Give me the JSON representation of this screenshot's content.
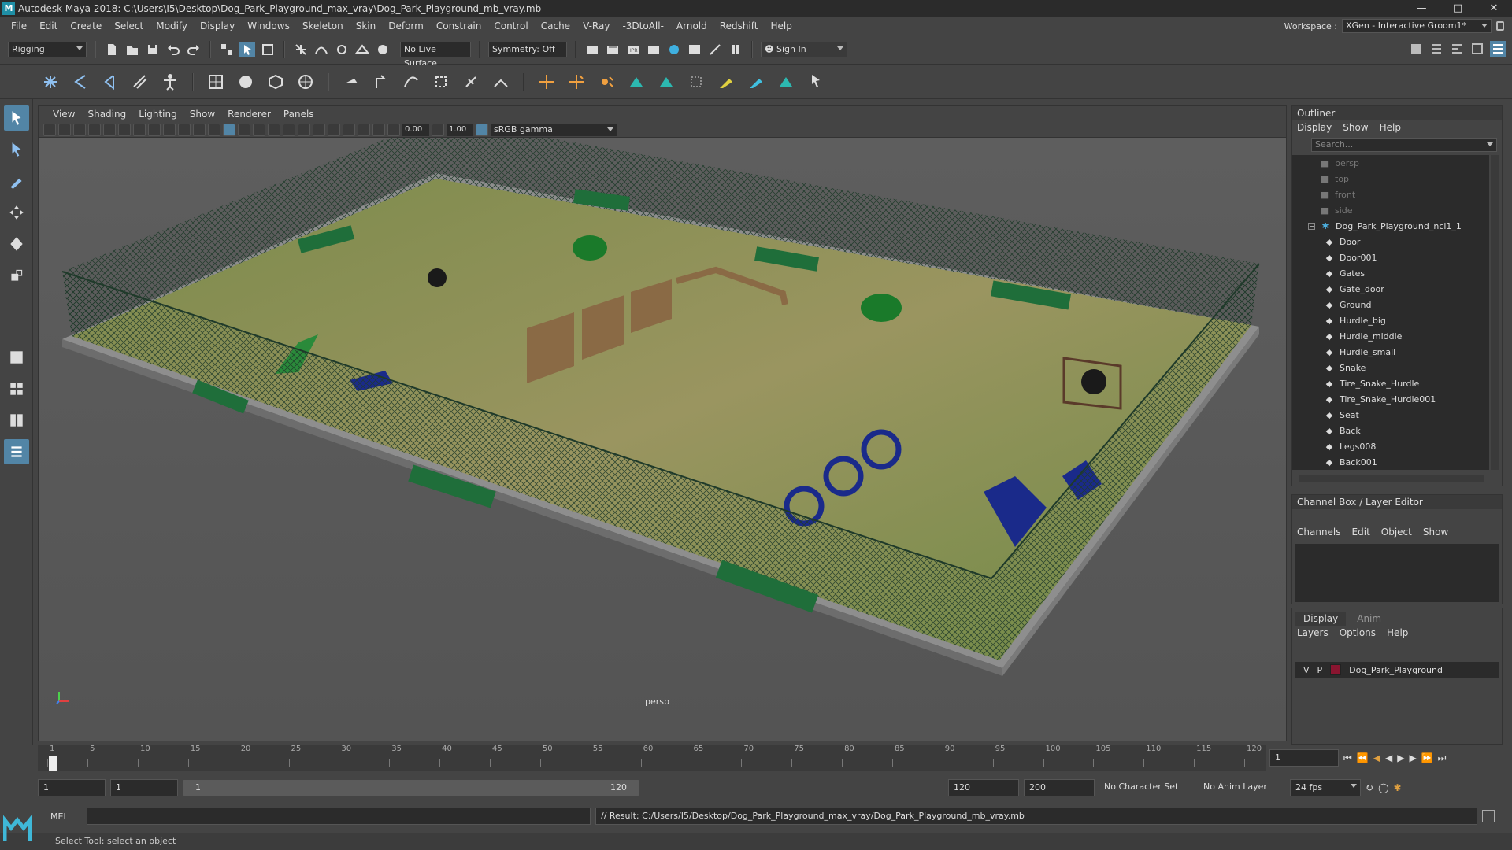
{
  "window": {
    "title": "Autodesk Maya 2018: C:\\Users\\I5\\Desktop\\Dog_Park_Playground_max_vray\\Dog_Park_Playground_mb_vray.mb",
    "logo_letter": "M"
  },
  "menubar": {
    "items": [
      "File",
      "Edit",
      "Create",
      "Select",
      "Modify",
      "Display",
      "Windows",
      "Skeleton",
      "Skin",
      "Deform",
      "Constrain",
      "Control",
      "Cache",
      "V-Ray",
      "-3DtoAll-",
      "Arnold",
      "Redshift",
      "Help"
    ],
    "workspace_label": "Workspace :",
    "workspace_value": "XGen - Interactive Groom1*"
  },
  "statusline": {
    "mode": "Rigging",
    "live_surface": "No Live Surface",
    "symmetry": "Symmetry: Off",
    "sign_in": "Sign In"
  },
  "panel": {
    "menus": [
      "View",
      "Shading",
      "Lighting",
      "Show",
      "Renderer",
      "Panels"
    ],
    "exposure": "0.00",
    "gamma_value": "1.00",
    "color_space": "sRGB gamma",
    "camera": "persp"
  },
  "outliner": {
    "title": "Outliner",
    "menus": [
      "Display",
      "Show",
      "Help"
    ],
    "search_placeholder": "Search...",
    "cameras": [
      "persp",
      "top",
      "front",
      "side"
    ],
    "root": "Dog_Park_Playground_ncl1_1",
    "children": [
      "Door",
      "Door001",
      "Gates",
      "Gate_door",
      "Ground",
      "Hurdle_big",
      "Hurdle_middle",
      "Hurdle_small",
      "Snake",
      "Tire_Snake_Hurdle",
      "Tire_Snake_Hurdle001",
      "Seat",
      "Back",
      "Legs008",
      "Back001"
    ]
  },
  "channelbox": {
    "title": "Channel Box / Layer Editor",
    "menus": [
      "Channels",
      "Edit",
      "Object",
      "Show"
    ]
  },
  "layereditor": {
    "tabs": [
      "Display",
      "Anim"
    ],
    "menus": [
      "Layers",
      "Options",
      "Help"
    ],
    "layer": {
      "v": "V",
      "p": "P",
      "name": "Dog_Park_Playground",
      "color": "#8a1530"
    }
  },
  "timeline": {
    "ticks": [
      "1",
      "5",
      "10",
      "15",
      "20",
      "25",
      "30",
      "35",
      "40",
      "45",
      "50",
      "55",
      "60",
      "65",
      "70",
      "75",
      "80",
      "85",
      "90",
      "95",
      "100",
      "105",
      "110",
      "115",
      "120"
    ],
    "current_frame": "1"
  },
  "range": {
    "start": "1",
    "playback_start": "1",
    "slider_start": "1",
    "slider_end": "120",
    "playback_end": "120",
    "end": "200",
    "character_set": "No Character Set",
    "anim_layer": "No Anim Layer",
    "fps": "24 fps"
  },
  "commandline": {
    "lang": "MEL",
    "result": "// Result: C:/Users/I5/Desktop/Dog_Park_Playground_max_vray/Dog_Park_Playground_mb_vray.mb"
  },
  "helpline": {
    "text": "Select Tool: select an object"
  }
}
